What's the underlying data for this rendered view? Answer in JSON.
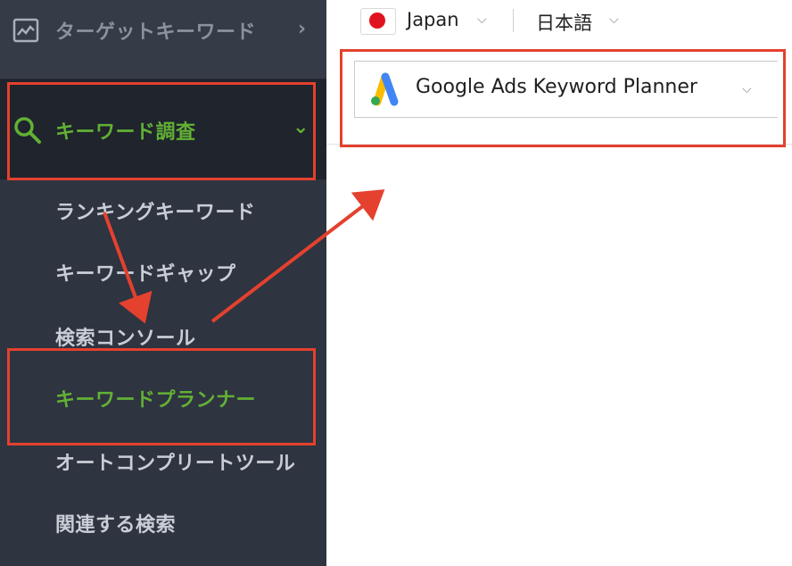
{
  "sidebar": {
    "items": [
      {
        "label": "ターゲットキーワード",
        "icon": "chart-line-icon",
        "chevron": "›"
      },
      {
        "label": "キーワード調査",
        "icon": "search-icon",
        "chevron": "⌄"
      }
    ],
    "subitems": [
      {
        "label": "ランキングキーワード"
      },
      {
        "label": "キーワードギャップ"
      },
      {
        "label": "検索コンソール"
      },
      {
        "label": "キーワードプランナー"
      },
      {
        "label": "オートコンプリートツール"
      },
      {
        "label": "関連する検索"
      }
    ]
  },
  "topbar": {
    "country": "Japan",
    "language": "日本語",
    "flag_icon": "japan-flag-icon"
  },
  "source_dropdown": {
    "selected": "Google Ads Keyword Planner",
    "icon": "google-ads-logo-icon"
  },
  "colors": {
    "sidebar_bg": "#2e3440",
    "accent_green": "#62b035",
    "annotation_red": "#e4412e"
  }
}
